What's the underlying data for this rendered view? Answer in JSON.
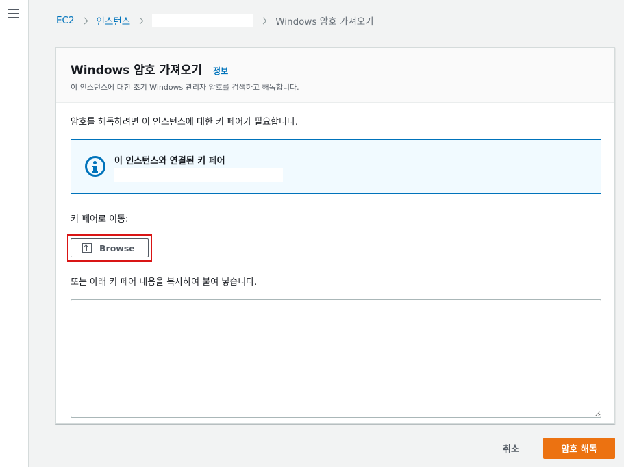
{
  "nav": {
    "menu_icon": "hamburger-icon"
  },
  "breadcrumb": {
    "items": [
      "EC2",
      "인스턴스",
      "",
      "Windows 암호 가져오기"
    ],
    "separator_icon": "chevron-right-icon"
  },
  "panel": {
    "title": "Windows 암호 가져오기",
    "info_link": "정보",
    "description": "이 인스턴스에 대한 초기 Windows 관리자 암호를 검색하고 해독합니다.",
    "intro": "암호를 해독하려면 이 인스턴스에 대한 키 페어가 필요합니다.",
    "alert": {
      "icon": "info-icon",
      "title": "이 인스턴스와 연결된 키 페어",
      "value": ""
    },
    "keypair_label": "키 페어로 이동:",
    "browse": {
      "label": "Browse",
      "icon": "upload-icon",
      "highlight_color": "#d91515"
    },
    "paste_label": "또는 아래 키 페어 내용을 복사하여 붙여 넣습니다.",
    "paste_value": ""
  },
  "footer": {
    "cancel_label": "취소",
    "decrypt_label": "암호 해독"
  },
  "colors": {
    "accent_orange": "#ec7211",
    "link_blue": "#0073bb",
    "background": "#f2f3f3"
  }
}
